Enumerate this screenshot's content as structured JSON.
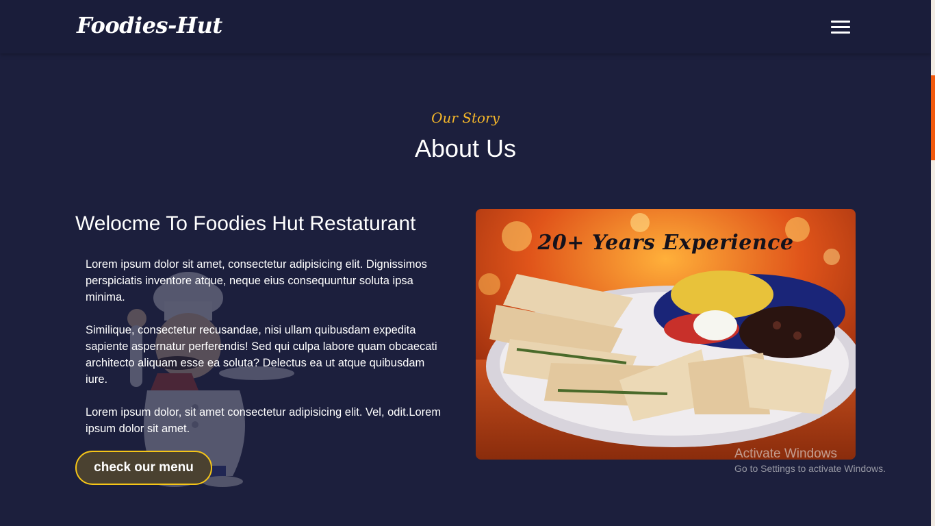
{
  "brand": {
    "logo_text": "Foodies-Hut"
  },
  "nav": {
    "menu_icon": "hamburger-menu-icon"
  },
  "about": {
    "kicker": "Our Story",
    "title": "About Us",
    "welcome_heading": "Welocme To Foodies Hut Restaturant",
    "paragraphs": [
      "Lorem ipsum dolor sit amet, consectetur adipisicing elit. Dignissimos perspiciatis inventore atque, neque eius consequuntur soluta ipsa minima.",
      "Similique, consectetur recusandae, nisi ullam quibusdam expedita sapiente aspernatur perferendis! Sed qui culpa labore quam obcaecati architecto aliquam esse ea soluta? Delectus ea ut atque quibusdam iure.",
      "Lorem ipsum dolor, sit amet consectetur adipisicing elit. Vel, odit.Lorem ipsum dolor sit amet."
    ],
    "menu_button": "check our menu",
    "photo_caption": "20+ Years Experience",
    "background_illustration": "chef-icon"
  },
  "windows_watermark": {
    "title": "Activate Windows",
    "subtitle": "Go to Settings to activate Windows."
  },
  "colors": {
    "background": "#1c1f3d",
    "navbar": "#1a1d3a",
    "accent_gold": "#f5b72a",
    "button_border": "#f5c518",
    "scroll_thumb": "#f25a0e"
  }
}
